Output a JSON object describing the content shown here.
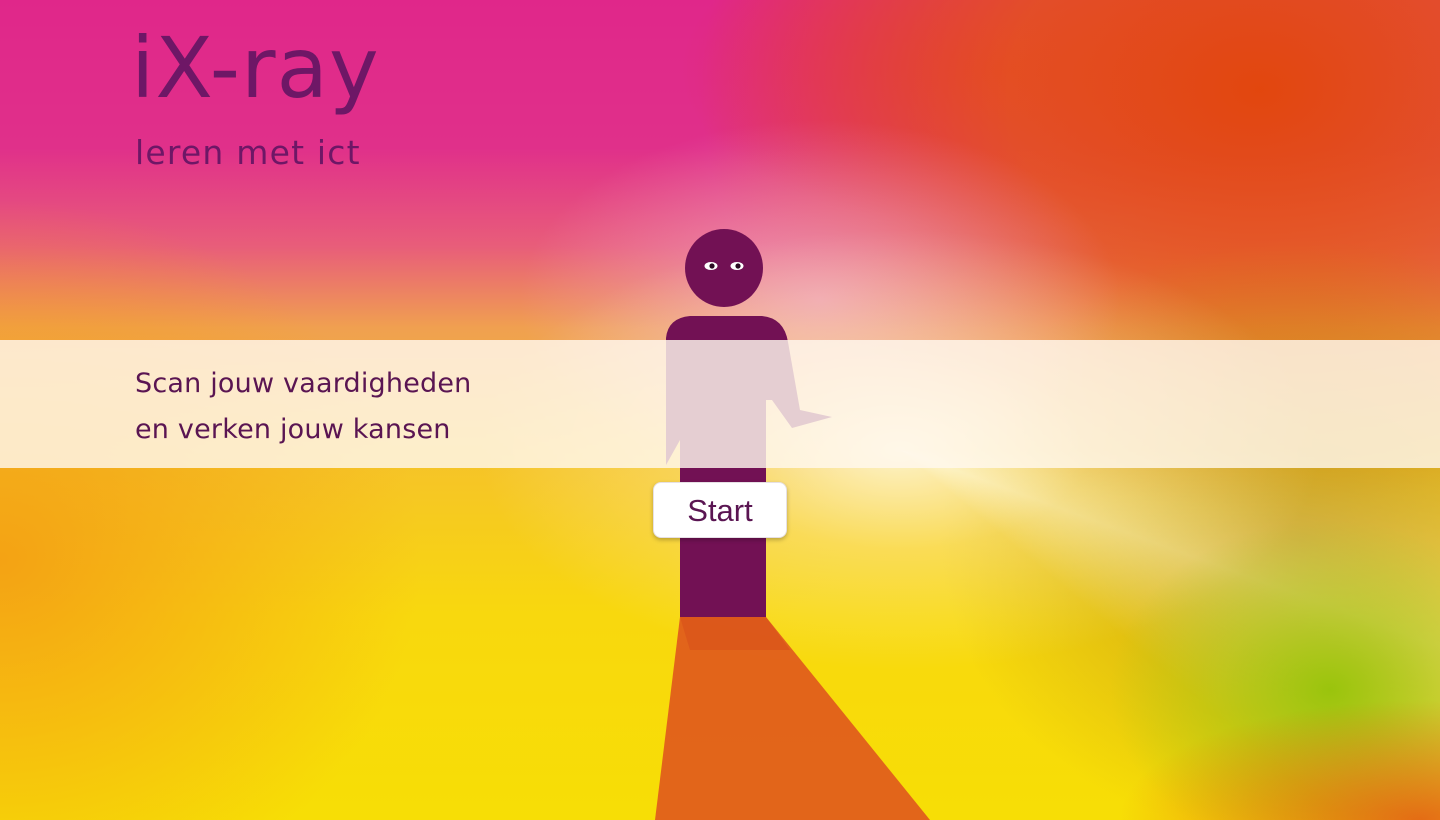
{
  "brand": {
    "title": "iX-ray",
    "subtitle": "leren met ict"
  },
  "intro": {
    "line1": "Scan jouw vaardigheden",
    "line2": "en verken jouw kansen"
  },
  "actions": {
    "start_label": "Start"
  },
  "colors": {
    "brand_purple": "#6e1766",
    "figure_purple": "#721154",
    "band_background": "#fff8ee",
    "button_background": "#ffffff"
  },
  "illustration": {
    "icon": "person-figure-illustration"
  }
}
